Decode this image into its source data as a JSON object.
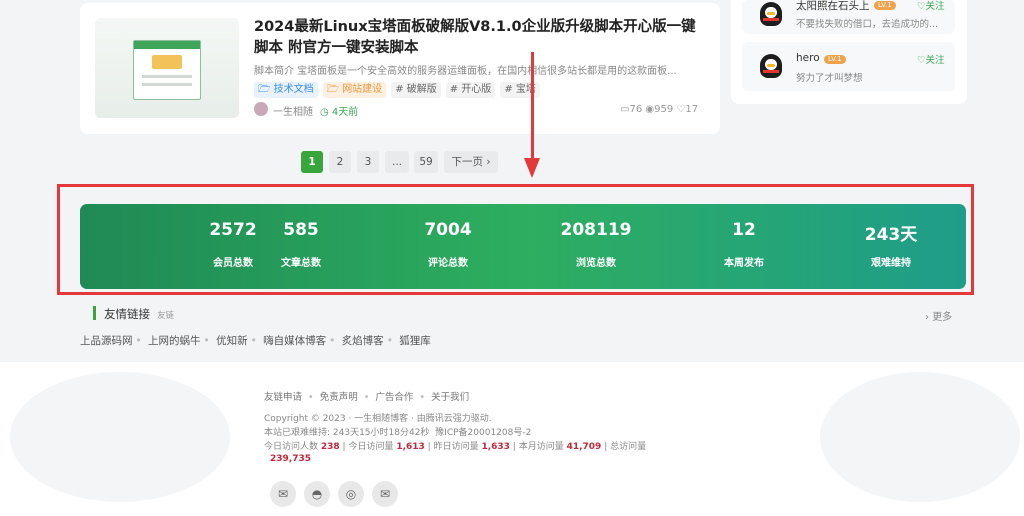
{
  "post": {
    "title": "2024最新Linux宝塔面板破解版V8.1.0企业版升级脚本开心版一键脚本 附官方一键安装脚本",
    "excerpt": "脚本简介 宝塔面板是一个安全高效的服务器运维面板，在国内相信很多站长都是用的这款面板...",
    "tags": [
      "技术文档",
      "网站建设",
      "# 破解版",
      "# 开心版",
      "# 宝塔"
    ],
    "author": "一生相随",
    "time": "4天前",
    "comments": "76",
    "views": "959",
    "likes": "17"
  },
  "sidebar": {
    "users": [
      {
        "name": "太阳照在石头上",
        "level": "LV.1",
        "follow": "关注",
        "desc": "不要找失败的借口，去追成功的..."
      },
      {
        "name": "hero",
        "level": "LV.1",
        "follow": "关注",
        "desc": "努力了才叫梦想"
      }
    ]
  },
  "pagination": {
    "pages": [
      "1",
      "2",
      "3",
      "...",
      "59"
    ],
    "next": "下一页",
    "current": "1"
  },
  "stats": [
    {
      "value": "2572",
      "label": "会员总数"
    },
    {
      "value": "585",
      "label": "文章总数"
    },
    {
      "value": "7004",
      "label": "评论总数"
    },
    {
      "value": "208119",
      "label": "浏览总数"
    },
    {
      "value": "12",
      "label": "本周发布"
    },
    {
      "value": "243天",
      "label": "艰难维持"
    }
  ],
  "friend_links": {
    "title": "友情链接",
    "subtitle": "友链",
    "more": "更多",
    "links": [
      "上品源码网",
      "上网的蜗牛",
      "优知新",
      "嗨自媒体博客",
      "炙焰博客",
      "狐狸库"
    ]
  },
  "footer": {
    "links": [
      "友链申请",
      "免责声明",
      "广告合作",
      "关于我们"
    ],
    "copyright": "Copyright © 2023 · 一生相随博客 · 由腾讯云强力驱动.",
    "uptime": "本站已艰难维持: 243天15小时18分42秒",
    "icp": "豫ICP备20001208号-2",
    "visits": {
      "today_visitors_label": "今日访问人数",
      "today_visitors": "238",
      "today_views_label": "今日访问量",
      "today_views": "1,613",
      "yesterday_label": "昨日访问量",
      "yesterday": "1,633",
      "month_label": "本月访问量",
      "month": "41,709",
      "total_label": "总访问量",
      "total": "239,735"
    }
  },
  "colors": {
    "accent": "#38a63c",
    "highlight": "#e3393a"
  },
  "icons": [
    "wechat-icon",
    "qq-icon",
    "weibo-icon",
    "mail-icon"
  ]
}
